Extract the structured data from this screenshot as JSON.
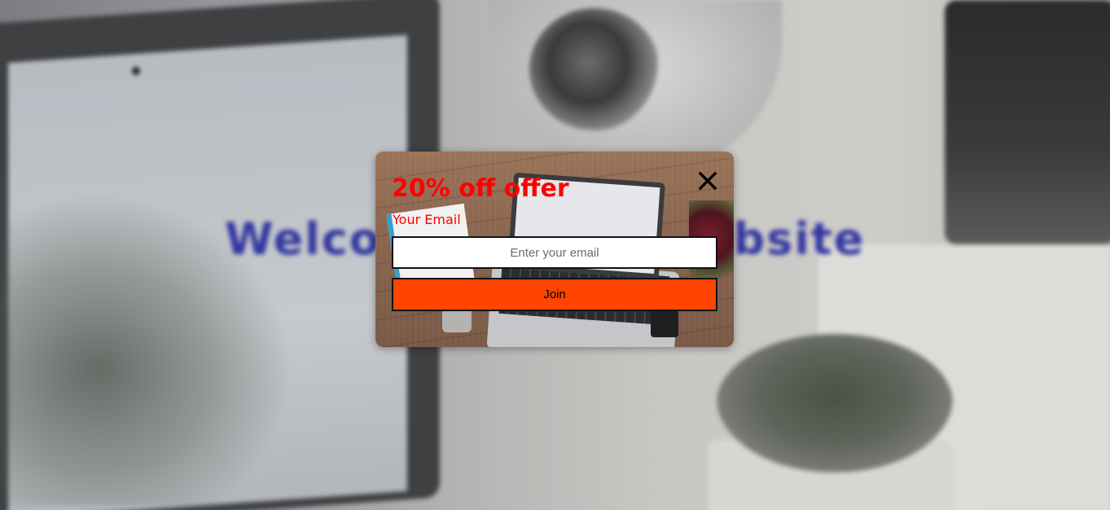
{
  "background": {
    "headline": "Welcome to our Website",
    "headline_color": "#3136a0"
  },
  "popup": {
    "title": "20% off offer",
    "email_label": "Your Email",
    "email_placeholder": "Enter your email",
    "email_value": "",
    "join_label": "Join",
    "close_icon": "close-icon",
    "accent_color": "#ff0000",
    "button_color": "#ff4500"
  }
}
